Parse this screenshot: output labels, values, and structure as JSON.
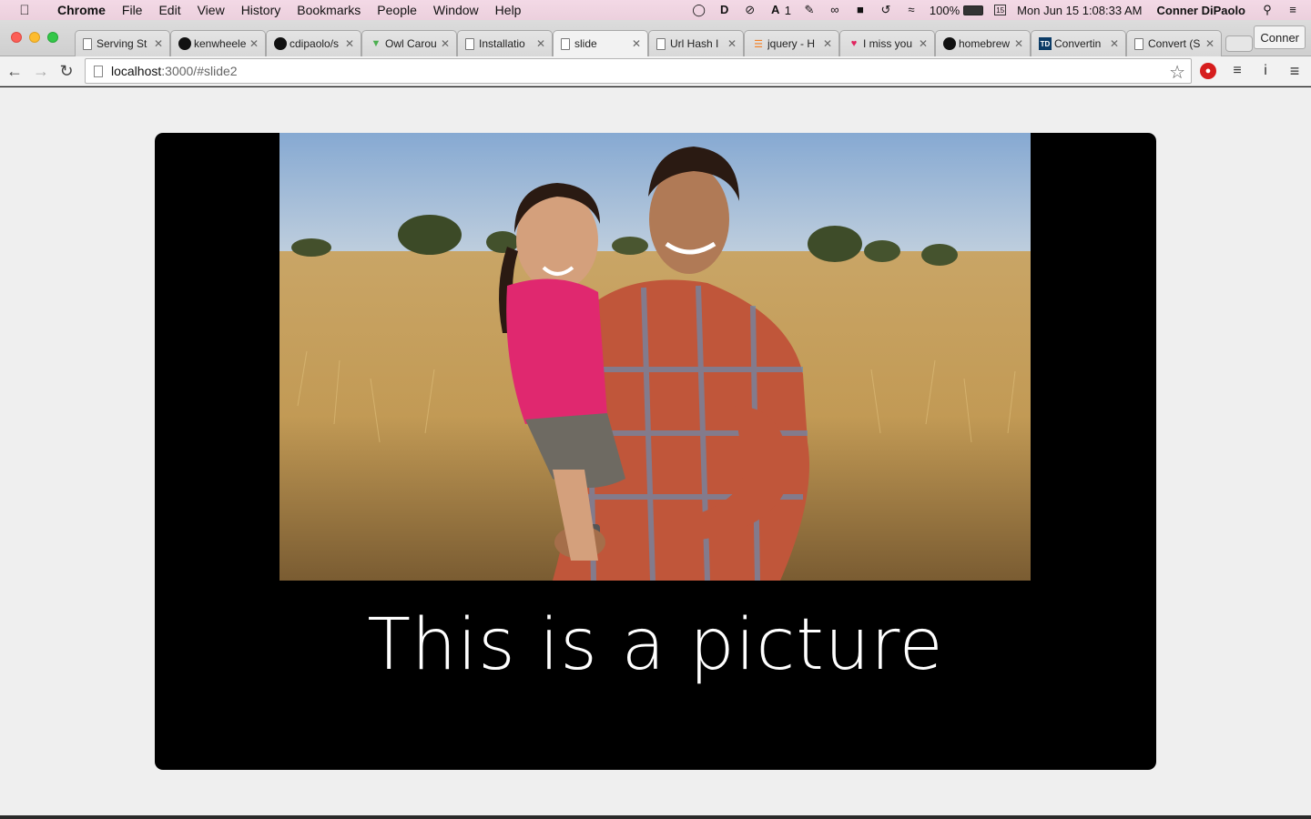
{
  "menubar": {
    "app": "Chrome",
    "items": [
      "File",
      "Edit",
      "View",
      "History",
      "Bookmarks",
      "People",
      "Window",
      "Help"
    ],
    "status": {
      "notif_count": "1",
      "battery": "100%",
      "datetime": "Mon Jun 15  1:08:33 AM",
      "user": "Conner DiPaolo"
    }
  },
  "tabs": [
    {
      "label": "Serving St",
      "icon": "document-icon",
      "active": false
    },
    {
      "label": "kenwheele",
      "icon": "github-icon",
      "active": false
    },
    {
      "label": "cdipaolo/s",
      "icon": "github-icon",
      "active": false
    },
    {
      "label": "Owl Carou",
      "icon": "owl-icon",
      "active": false
    },
    {
      "label": "Installatio",
      "icon": "document-icon",
      "active": false
    },
    {
      "label": "slide",
      "icon": "document-icon",
      "active": true
    },
    {
      "label": "Url Hash I",
      "icon": "document-icon",
      "active": false
    },
    {
      "label": "jquery - H",
      "icon": "stackoverflow-icon",
      "active": false
    },
    {
      "label": "I miss you",
      "icon": "heart-icon",
      "active": false
    },
    {
      "label": "homebrew",
      "icon": "github-icon",
      "active": false
    },
    {
      "label": "Convertin",
      "icon": "td-icon",
      "active": false
    },
    {
      "label": "Convert (S",
      "icon": "document-icon",
      "active": false
    }
  ],
  "profile": "Conner",
  "address": {
    "host": "localhost",
    "path": ":3000/#slide2"
  },
  "slide": {
    "caption": "This is a picture"
  }
}
